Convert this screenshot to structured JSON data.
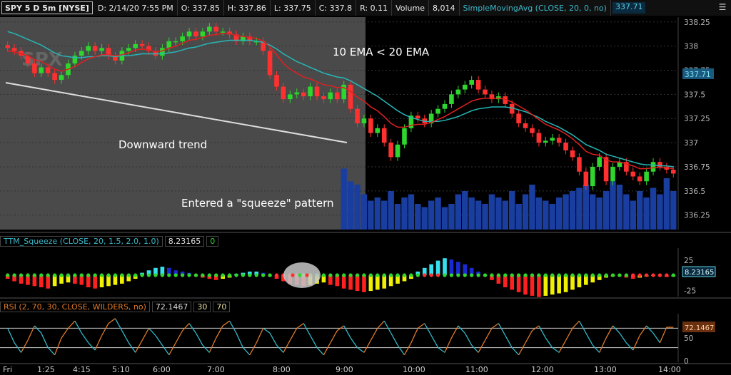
{
  "toolbar": {
    "symbol": "SPY 5 D 5m [NYSE]",
    "date": "D: 2/14/20 7:55 PM",
    "open": "O: 337.85",
    "high": "H: 337.86",
    "low": "L: 337.75",
    "close": "C: 337.8",
    "range": "R: 0.11",
    "volume_label": "Volume",
    "volume_value": "8,014",
    "sma_label": "SimpleMovingAvg (CLOSE, 20, 0, no)",
    "sma_value": "337.71",
    "icon": "horizontal-lines-icon"
  },
  "annotations": {
    "ema_note": "10 EMA < 20 EMA",
    "trend_note": "Downward trend",
    "squeeze_note": "Entered a \"squeeze\" pattern"
  },
  "watermark": "SPX",
  "squeeze_panel": {
    "label": "TTM_Squeeze (CLOSE, 20, 1.5, 2.0, 1.0)",
    "value": "8.23165",
    "value2": "0"
  },
  "rsi_panel": {
    "label": "RSI (2, 70, 30, CLOSE, WILDERS, no)",
    "value": "72.1467",
    "over": "30",
    "under": "70"
  },
  "colors": {
    "up": "#2ed62e",
    "down": "#ff3030",
    "ema10": "#e02020",
    "ema20": "#26b6b6",
    "volume": "#1a3ea0",
    "shade": "#4a4a4a",
    "hist_cyan": "#35e0f0",
    "hist_blue": "#1a2ad0",
    "hist_red": "#ff2020",
    "hist_yellow": "#f0f000",
    "rsi_rising": "#e07a28",
    "rsi_falling": "#30b8c8"
  },
  "chart_data": [
    {
      "type": "candlestick",
      "x_tick_labels": [
        "Fri",
        "1:25",
        "4:15",
        "5:10",
        "6:00",
        "7:00",
        "8:00",
        "9:00",
        "10:00",
        "11:00",
        "12:00",
        "13:00",
        "14:00"
      ],
      "ylim": [
        336.1,
        338.3
      ],
      "y_ticks": [
        336.25,
        336.5,
        336.75,
        337,
        337.25,
        337.5,
        337.75,
        338,
        338.25
      ],
      "y_tick_labels": [
        "336.25",
        "336.5",
        "336.75",
        "337",
        "337.25",
        "337.5",
        "337.75",
        "338",
        "338.25"
      ],
      "last_price": 337.71,
      "last_price_label": "337.71",
      "candles_close": [
        337.98,
        337.95,
        337.9,
        337.82,
        337.72,
        337.78,
        337.72,
        337.65,
        337.7,
        337.82,
        337.9,
        337.95,
        338.0,
        337.95,
        337.98,
        337.9,
        337.85,
        337.95,
        337.98,
        338.02,
        338.0,
        337.95,
        337.9,
        337.98,
        338.05,
        338.05,
        338.1,
        338.15,
        338.1,
        338.15,
        338.2,
        338.15,
        338.15,
        338.12,
        338.05,
        338.1,
        338.05,
        338.05,
        337.95,
        337.7,
        337.58,
        337.45,
        337.5,
        337.52,
        337.48,
        337.58,
        337.48,
        337.45,
        337.52,
        337.45,
        337.6,
        337.35,
        337.2,
        337.25,
        337.1,
        337.15,
        337.0,
        336.85,
        336.98,
        337.15,
        337.28,
        337.25,
        337.2,
        337.3,
        337.35,
        337.4,
        337.5,
        337.55,
        337.6,
        337.65,
        337.55,
        337.5,
        337.45,
        337.48,
        337.4,
        337.3,
        337.2,
        337.15,
        337.1,
        337.0,
        337.02,
        337.05,
        337.0,
        336.92,
        336.85,
        336.7,
        336.55,
        336.75,
        336.85,
        336.6,
        336.75,
        336.8,
        336.7,
        336.65,
        336.6,
        336.7,
        336.8,
        336.75,
        336.72,
        336.68
      ],
      "ema10_values": [
        337.95,
        337.94,
        337.92,
        337.9,
        337.86,
        337.84,
        337.8,
        337.76,
        337.74,
        337.76,
        337.79,
        337.83,
        337.87,
        337.89,
        337.91,
        337.91,
        337.9,
        337.91,
        337.93,
        337.96,
        337.97,
        337.96,
        337.94,
        337.95,
        337.98,
        338.0,
        338.03,
        338.06,
        338.07,
        338.09,
        338.11,
        338.12,
        338.13,
        338.13,
        338.11,
        338.1,
        338.09,
        338.08,
        338.05,
        337.99,
        337.91,
        337.82,
        337.76,
        337.72,
        337.68,
        337.66,
        337.63,
        337.6,
        337.59,
        337.57,
        337.57,
        337.53,
        337.47,
        337.43,
        337.37,
        337.33,
        337.27,
        337.2,
        337.16,
        337.16,
        337.18,
        337.19,
        337.19,
        337.21,
        337.24,
        337.27,
        337.31,
        337.35,
        337.39,
        337.43,
        337.45,
        337.46,
        337.46,
        337.46,
        337.45,
        337.42,
        337.38,
        337.34,
        337.29,
        337.24,
        337.19,
        337.16,
        337.13,
        337.09,
        337.04,
        336.98,
        336.91,
        336.88,
        336.87,
        336.82,
        336.8,
        336.8,
        336.78,
        336.76,
        336.73,
        336.73,
        336.74,
        336.74,
        336.74,
        336.73
      ],
      "ema20_values": [
        338.15,
        338.13,
        338.1,
        338.07,
        338.04,
        338.01,
        337.97,
        337.93,
        337.9,
        337.89,
        337.88,
        337.88,
        337.89,
        337.89,
        337.9,
        337.9,
        337.89,
        337.9,
        337.9,
        337.91,
        337.92,
        337.92,
        337.92,
        337.92,
        337.93,
        337.94,
        337.96,
        337.98,
        337.99,
        338.01,
        338.03,
        338.04,
        338.05,
        338.06,
        338.06,
        338.06,
        338.06,
        338.05,
        338.04,
        338.01,
        337.97,
        337.92,
        337.88,
        337.84,
        337.81,
        337.78,
        337.75,
        337.72,
        337.7,
        337.68,
        337.67,
        337.64,
        337.6,
        337.56,
        337.52,
        337.48,
        337.43,
        337.38,
        337.33,
        337.29,
        337.26,
        337.24,
        337.22,
        337.22,
        337.22,
        337.23,
        337.25,
        337.27,
        337.3,
        337.33,
        337.35,
        337.36,
        337.37,
        337.37,
        337.37,
        337.36,
        337.34,
        337.32,
        337.29,
        337.26,
        337.22,
        337.19,
        337.16,
        337.12,
        337.08,
        337.03,
        336.98,
        336.95,
        336.92,
        336.88,
        336.86,
        336.84,
        336.82,
        336.8,
        336.78,
        336.77,
        336.77,
        336.76,
        336.76,
        336.75
      ],
      "volume_values": [
        0,
        0,
        0,
        0,
        0,
        0,
        0,
        0,
        0,
        0,
        0,
        0,
        0,
        0,
        0,
        0,
        0,
        0,
        0,
        0,
        0,
        0,
        0,
        0,
        0,
        0,
        0,
        0,
        0,
        0,
        0,
        0,
        0,
        0,
        0,
        0,
        0,
        0,
        0,
        0,
        0,
        0,
        0,
        0,
        0,
        0,
        0,
        0,
        0,
        0,
        0.95,
        0.75,
        0.7,
        0.55,
        0.45,
        0.5,
        0.45,
        0.6,
        0.4,
        0.5,
        0.55,
        0.4,
        0.35,
        0.45,
        0.5,
        0.35,
        0.4,
        0.55,
        0.6,
        0.5,
        0.45,
        0.4,
        0.55,
        0.5,
        0.45,
        0.6,
        0.4,
        0.55,
        0.7,
        0.5,
        0.45,
        0.4,
        0.5,
        0.55,
        0.6,
        0.65,
        0.7,
        0.55,
        0.5,
        0.6,
        0.75,
        0.7,
        0.55,
        0.45,
        0.6,
        0.5,
        0.65,
        0.55,
        0.8,
        0.6
      ]
    },
    {
      "type": "histogram",
      "name": "TTM_Squeeze",
      "y_tick_labels": [
        "25",
        "-25"
      ],
      "ylim": [
        -40,
        40
      ],
      "values": [
        -6,
        -10,
        -14,
        -16,
        -18,
        -20,
        -22,
        -18,
        -14,
        -12,
        -14,
        -16,
        -20,
        -22,
        -20,
        -18,
        -16,
        -14,
        -10,
        -6,
        4,
        8,
        12,
        14,
        12,
        8,
        6,
        4,
        -2,
        -4,
        -6,
        -8,
        -6,
        -4,
        2,
        4,
        6,
        6,
        4,
        -2,
        -6,
        -10,
        -14,
        -16,
        -18,
        -16,
        -14,
        -12,
        -16,
        -18,
        -22,
        -24,
        -26,
        -28,
        -26,
        -24,
        -22,
        -18,
        -14,
        -10,
        -6,
        6,
        12,
        18,
        24,
        28,
        26,
        22,
        18,
        12,
        6,
        -2,
        -8,
        -14,
        -20,
        -24,
        -28,
        -32,
        -34,
        -36,
        -34,
        -32,
        -30,
        -28,
        -24,
        -20,
        -16,
        -12,
        -8,
        -4,
        -2,
        -2,
        -4,
        -6,
        -4,
        -2,
        -1,
        -2,
        -3,
        -2
      ],
      "dots": "green except a short red run near the gray circle and around 11:00 and 14:00"
    },
    {
      "type": "line",
      "name": "RSI",
      "ylim": [
        0,
        100
      ],
      "y_tick_labels": [
        "50",
        "0"
      ],
      "reference_levels": [
        30,
        70
      ],
      "values": [
        70,
        40,
        20,
        45,
        75,
        60,
        30,
        15,
        50,
        70,
        85,
        60,
        40,
        25,
        55,
        80,
        90,
        65,
        40,
        20,
        45,
        70,
        55,
        35,
        15,
        40,
        65,
        80,
        60,
        35,
        20,
        50,
        75,
        85,
        60,
        30,
        15,
        40,
        70,
        60,
        35,
        20,
        45,
        70,
        80,
        55,
        30,
        15,
        40,
        65,
        75,
        50,
        30,
        20,
        45,
        70,
        85,
        60,
        35,
        15,
        40,
        70,
        80,
        55,
        30,
        20,
        50,
        75,
        60,
        35,
        20,
        45,
        70,
        80,
        55,
        30,
        15,
        40,
        65,
        75,
        50,
        30,
        20,
        45,
        70,
        85,
        60,
        35,
        20,
        50,
        75,
        60,
        40,
        25,
        55,
        75,
        60,
        40,
        72,
        72
      ]
    }
  ]
}
